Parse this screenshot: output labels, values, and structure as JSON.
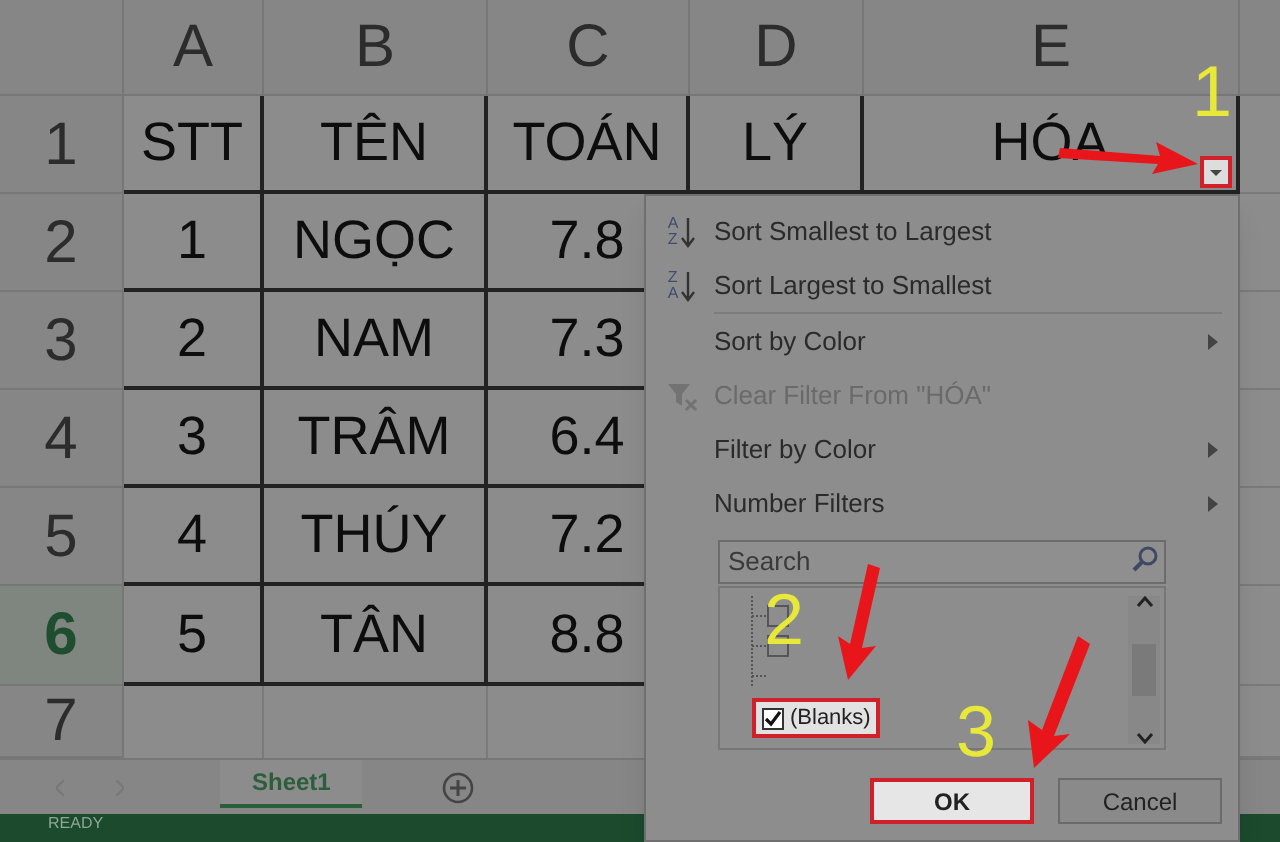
{
  "columns": [
    "A",
    "B",
    "C",
    "D",
    "E"
  ],
  "rows": [
    {
      "number": "1",
      "selected": false,
      "cells": [
        "STT",
        "TÊN",
        "TOÁN",
        "LÝ",
        "HÓA"
      ]
    },
    {
      "number": "2",
      "selected": false,
      "cells": [
        "1",
        "NGỌC",
        "7.8",
        "",
        ""
      ]
    },
    {
      "number": "3",
      "selected": false,
      "cells": [
        "2",
        "NAM",
        "7.3",
        "",
        ""
      ]
    },
    {
      "number": "4",
      "selected": false,
      "cells": [
        "3",
        "TRÂM",
        "6.4",
        "",
        ""
      ]
    },
    {
      "number": "5",
      "selected": false,
      "cells": [
        "4",
        "THÚY",
        "7.2",
        "",
        ""
      ]
    },
    {
      "number": "6",
      "selected": true,
      "cells": [
        "5",
        "TÂN",
        "8.8",
        "",
        ""
      ]
    },
    {
      "number": "7",
      "selected": false,
      "cells": [
        "",
        "",
        "",
        "",
        ""
      ]
    }
  ],
  "filter_menu": {
    "items": [
      {
        "kind": "sort-asc",
        "icon_letters": [
          "A",
          "Z"
        ],
        "label": "Sort Smallest to Largest",
        "disabled": false,
        "submenu": false
      },
      {
        "kind": "sort-desc",
        "icon_letters": [
          "Z",
          "A"
        ],
        "label": "Sort Largest to Smallest",
        "disabled": false,
        "submenu": false
      },
      {
        "kind": "plain",
        "label": "Sort by Color",
        "disabled": false,
        "submenu": true
      },
      {
        "kind": "clear",
        "label": "Clear Filter From \"HÓA\"",
        "disabled": true,
        "submenu": false
      },
      {
        "kind": "plain",
        "label": "Filter by Color",
        "disabled": false,
        "submenu": true
      },
      {
        "kind": "plain",
        "label": "Number Filters",
        "disabled": false,
        "submenu": true
      }
    ],
    "search": {
      "placeholder": "Search"
    },
    "values": [
      {
        "label": "(Blanks)",
        "checked": true
      }
    ],
    "buttons": [
      {
        "label": "OK",
        "highlighted": true
      },
      {
        "label": "Cancel",
        "highlighted": false
      }
    ]
  },
  "annotations": [
    "1",
    "2",
    "3"
  ],
  "sheet_tabs": [
    {
      "label": "Sheet1",
      "selected": true
    }
  ],
  "status_bar": "READY"
}
